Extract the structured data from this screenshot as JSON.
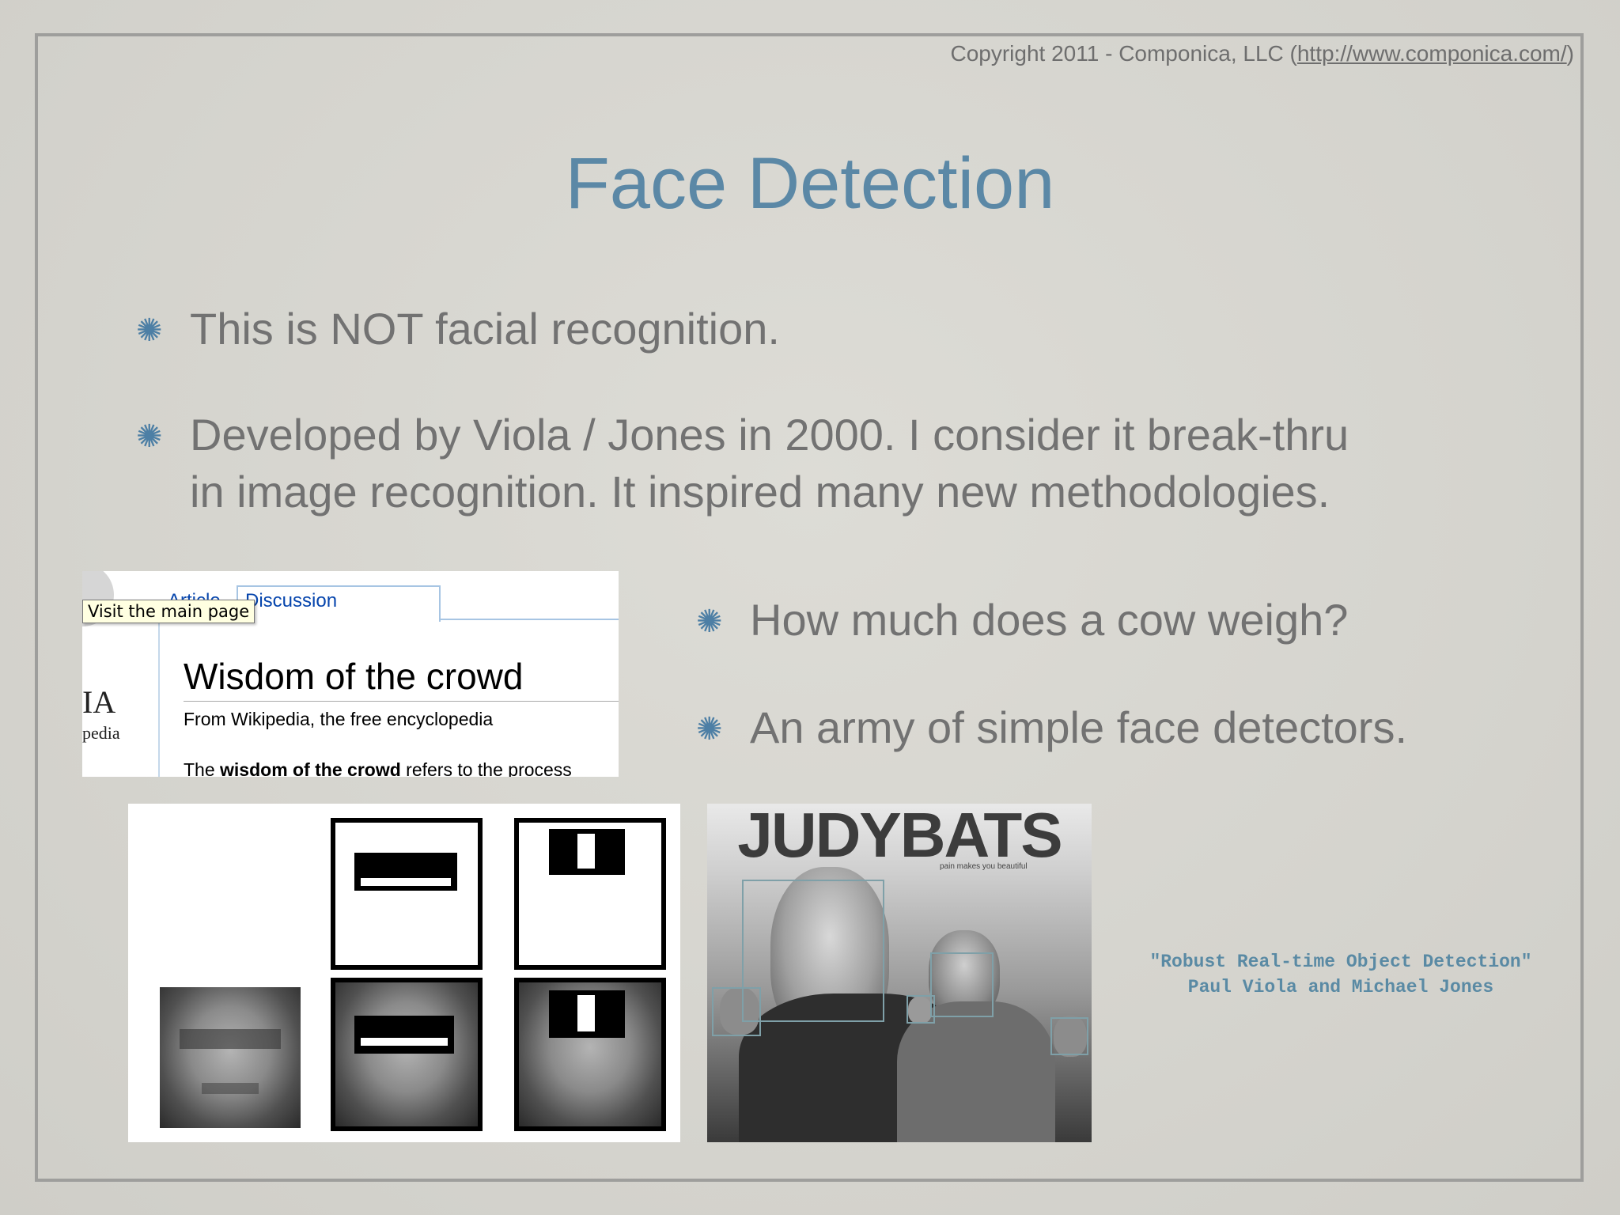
{
  "copyright": {
    "prefix": "Copyright 2011 - Componica, LLC (",
    "link": "http://www.componica.com/",
    "suffix": ")"
  },
  "title": "Face Detection",
  "bullets": [
    {
      "lines": [
        "This is NOT facial recognition."
      ]
    },
    {
      "lines": [
        "Developed by Viola / Jones in 2000. I consider it break-thru",
        "in image recognition. It inspired many new methodologies."
      ]
    },
    {
      "lines": [
        "How much does a cow weigh?"
      ]
    },
    {
      "lines": [
        "An army of simple face detectors."
      ]
    }
  ],
  "bullet_symbol": "✺",
  "wiki_screenshot": {
    "tooltip": "Visit the main page",
    "tab_article": "Article",
    "tab_discussion": "Discussion",
    "heading": "Wisdom of the crowd",
    "subheading": "From Wikipedia, the free encyclopedia",
    "body_prefix": "The ",
    "body_bold": "wisdom of the crowd",
    "body_suffix": " refers to the process",
    "logo_text": "IA",
    "logo_sub": "pedia"
  },
  "photo": {
    "brand": "JUDYBATS",
    "tagline": "pain makes you beautiful"
  },
  "citation": {
    "line1": "\"Robust Real-time Object Detection\"",
    "line2": "Paul Viola and Michael Jones"
  },
  "colors": {
    "title": "#5b88a6",
    "body_text": "#727272",
    "bullet": "#4d7fa5",
    "citation": "#5a8aa4"
  }
}
